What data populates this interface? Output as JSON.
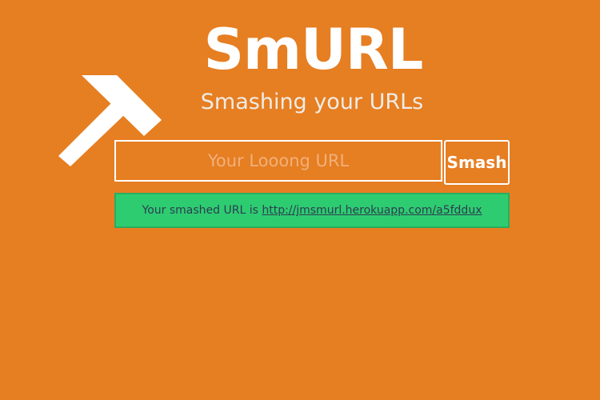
{
  "header": {
    "title": "SmURL",
    "subtitle": "Smashing your URLs"
  },
  "logo": {
    "icon": "hammer-icon",
    "color": "#ffffff"
  },
  "form": {
    "url_placeholder": "Your Looong URL",
    "url_value": "",
    "submit_label": "Smash"
  },
  "result": {
    "prefix": "Your smashed URL is ",
    "link_text": "http://jmsmurl.herokuapp.com/a5fddux",
    "link_href": "http://jmsmurl.herokuapp.com/a5fddux"
  },
  "colors": {
    "background": "#e67e22",
    "success": "#2ecc71",
    "success_border": "#27ae60",
    "text_dark": "#2c3e50"
  }
}
